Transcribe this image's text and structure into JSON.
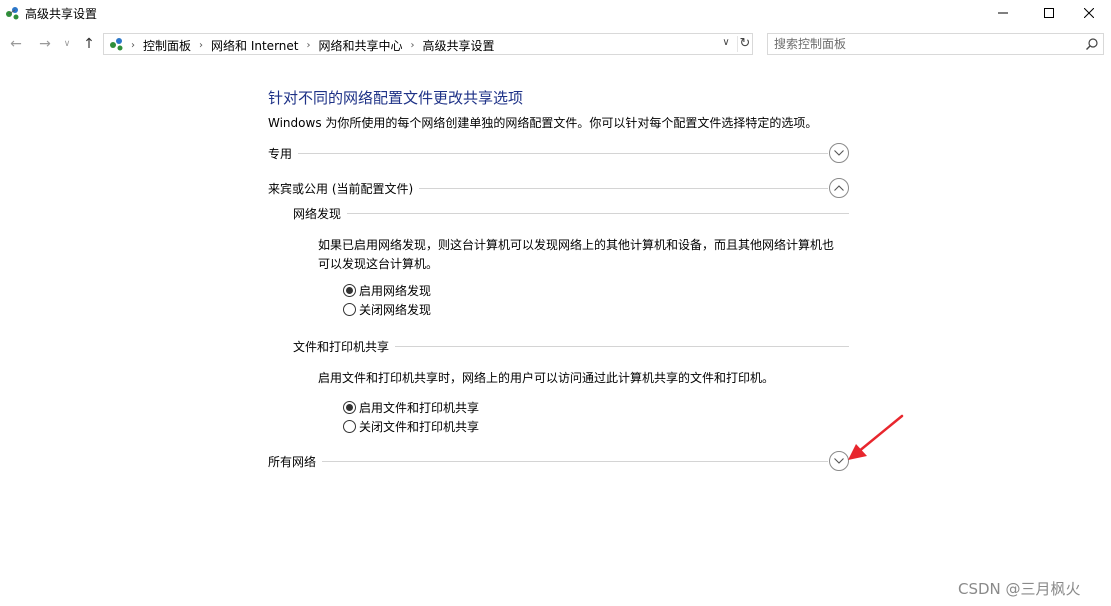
{
  "window": {
    "title": "高级共享设置",
    "icon": "network-sharing-icon"
  },
  "address": {
    "breadcrumbs": [
      "控制面板",
      "网络和 Internet",
      "网络和共享中心",
      "高级共享设置"
    ]
  },
  "search": {
    "placeholder": "搜索控制面板"
  },
  "main": {
    "heading": "针对不同的网络配置文件更改共享选项",
    "description": "Windows 为你所使用的每个网络创建单独的网络配置文件。你可以针对每个配置文件选择特定的选项。",
    "profiles": {
      "private": {
        "label": "专用",
        "state": "collapsed"
      },
      "guest_public": {
        "label": "来宾或公用 (当前配置文件)",
        "state": "expanded",
        "network_discovery": {
          "label": "网络发现",
          "text_line1": "如果已启用网络发现，则这台计算机可以发现网络上的其他计算机和设备，而且其他网络计算机也",
          "text_line2": "可以发现这台计算机。",
          "options": [
            "启用网络发现",
            "关闭网络发现"
          ],
          "selected": "启用网络发现"
        },
        "file_printer_sharing": {
          "label": "文件和打印机共享",
          "text": "启用文件和打印机共享时，网络上的用户可以访问通过此计算机共享的文件和打印机。",
          "options": [
            "启用文件和打印机共享",
            "关闭文件和打印机共享"
          ],
          "selected": "启用文件和打印机共享"
        }
      },
      "all_networks": {
        "label": "所有网络",
        "state": "collapsed"
      }
    }
  },
  "watermark": "CSDN @三月枫火",
  "colors": {
    "heading": "#1e3287",
    "annotation_arrow": "#e8262d"
  }
}
